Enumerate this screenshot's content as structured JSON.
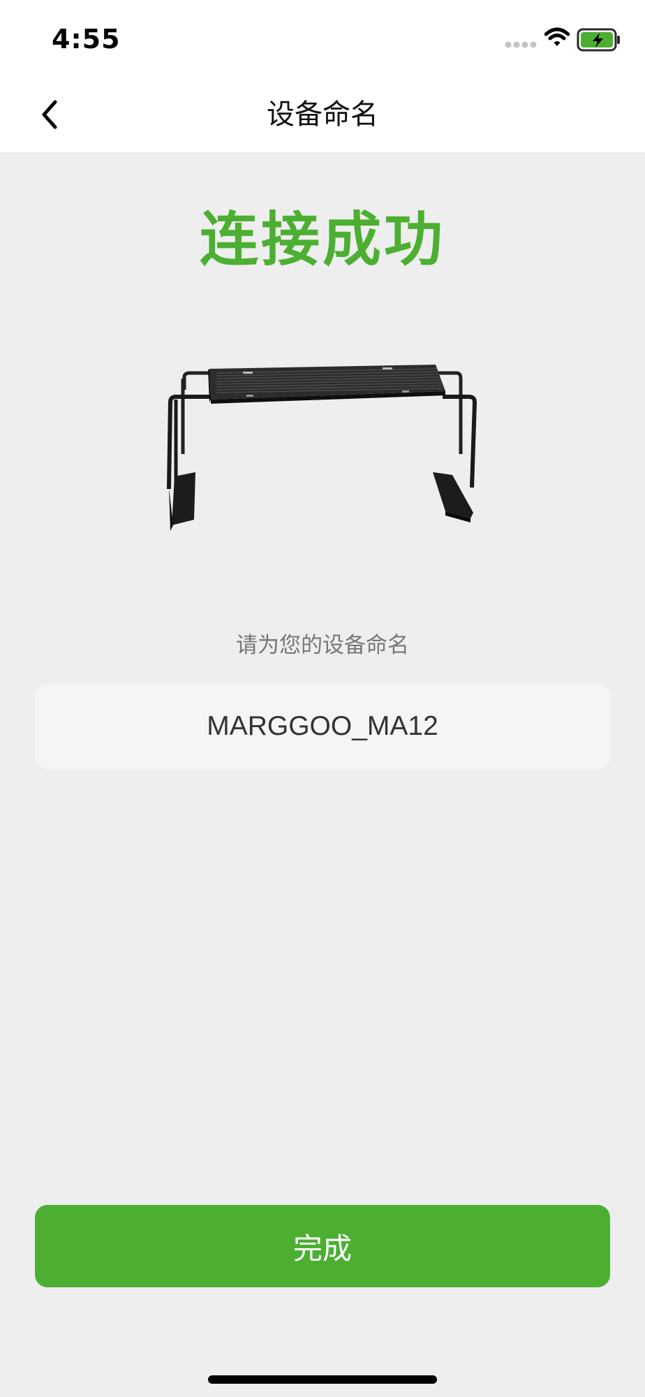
{
  "status_bar": {
    "time": "4:55",
    "icons": [
      "cellular-signal-icon",
      "wifi-icon",
      "battery-charging-icon"
    ],
    "battery_color": "#4caf32"
  },
  "nav": {
    "title": "设备命名",
    "back_icon": "chevron-left-icon"
  },
  "main": {
    "success_title": "连接成功",
    "name_prompt": "请为您的设备命名",
    "device_name_value": "MARGGOO_MA12",
    "done_label": "完成"
  },
  "colors": {
    "accent": "#4caf32",
    "background": "#eeeeee",
    "input_background": "#f4f5f7",
    "header_background": "#ffffff"
  }
}
